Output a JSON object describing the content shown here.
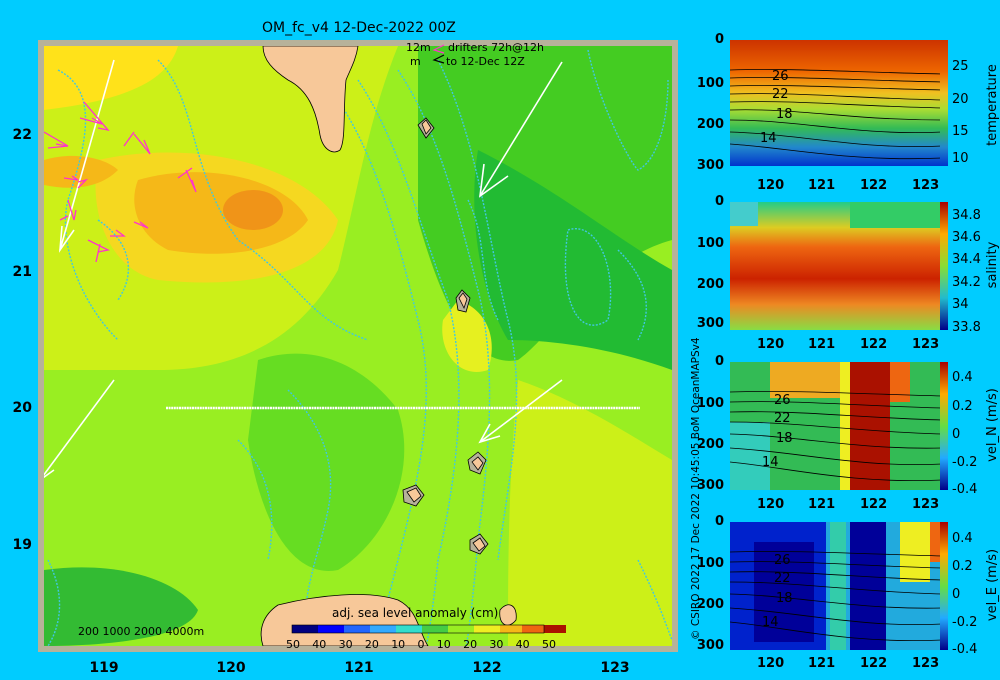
{
  "title": "OM_fc_v4  12-Dec-2022 00Z",
  "drifters": {
    "line1_left": "12m",
    "line1_right": "drifters 72h@12h",
    "line2_left": "m",
    "line2_right": "to 12-Dec 12Z"
  },
  "map": {
    "yticks": [
      "22",
      "21",
      "20",
      "19"
    ],
    "xticks": [
      "119",
      "120",
      "121",
      "122",
      "123"
    ],
    "depth_legend": "200  1000  2000  4000m",
    "colorbar_label": "adj. sea level anomaly (cm)",
    "colorbar_ticks": [
      "50",
      "40",
      "30",
      "20",
      "10",
      "0",
      "10",
      "20",
      "30",
      "40",
      "50"
    ]
  },
  "credit": "© CSIRO 2022   17 Dec 2022 10:45:05 BoM OceanMAPSv4",
  "panels": [
    {
      "label": "temperature",
      "yticks": [
        "0",
        "100",
        "200",
        "300"
      ],
      "xticks": [
        "120",
        "121",
        "122",
        "123"
      ],
      "cbar_ticks": [
        "25",
        "20",
        "15",
        "10"
      ],
      "contour_labels": [
        "26",
        "22",
        "18",
        "14"
      ]
    },
    {
      "label": "salinity",
      "yticks": [
        "0",
        "100",
        "200",
        "300"
      ],
      "xticks": [
        "120",
        "121",
        "122",
        "123"
      ],
      "cbar_ticks": [
        "34.8",
        "34.6",
        "34.4",
        "34.2",
        "34",
        "33.8"
      ],
      "contour_labels": []
    },
    {
      "label": "vel_N (m/s)",
      "yticks": [
        "0",
        "100",
        "200",
        "300"
      ],
      "xticks": [
        "120",
        "121",
        "122",
        "123"
      ],
      "cbar_ticks": [
        "0.4",
        "0.2",
        "0",
        "-0.2",
        "-0.4"
      ],
      "contour_labels": [
        "26",
        "22",
        "18",
        "14"
      ]
    },
    {
      "label": "vel_E (m/s)",
      "yticks": [
        "0",
        "100",
        "200",
        "300"
      ],
      "xticks": [
        "120",
        "121",
        "122",
        "123"
      ],
      "cbar_ticks": [
        "0.4",
        "0.2",
        "0",
        "-0.2",
        "-0.4"
      ],
      "contour_labels": [
        "26",
        "22",
        "18",
        "14"
      ]
    }
  ],
  "colors": {
    "background": "#00ccff",
    "land": "#f7c899",
    "coast_frame": "#b7b29a",
    "isobath": "#40c8e0"
  }
}
